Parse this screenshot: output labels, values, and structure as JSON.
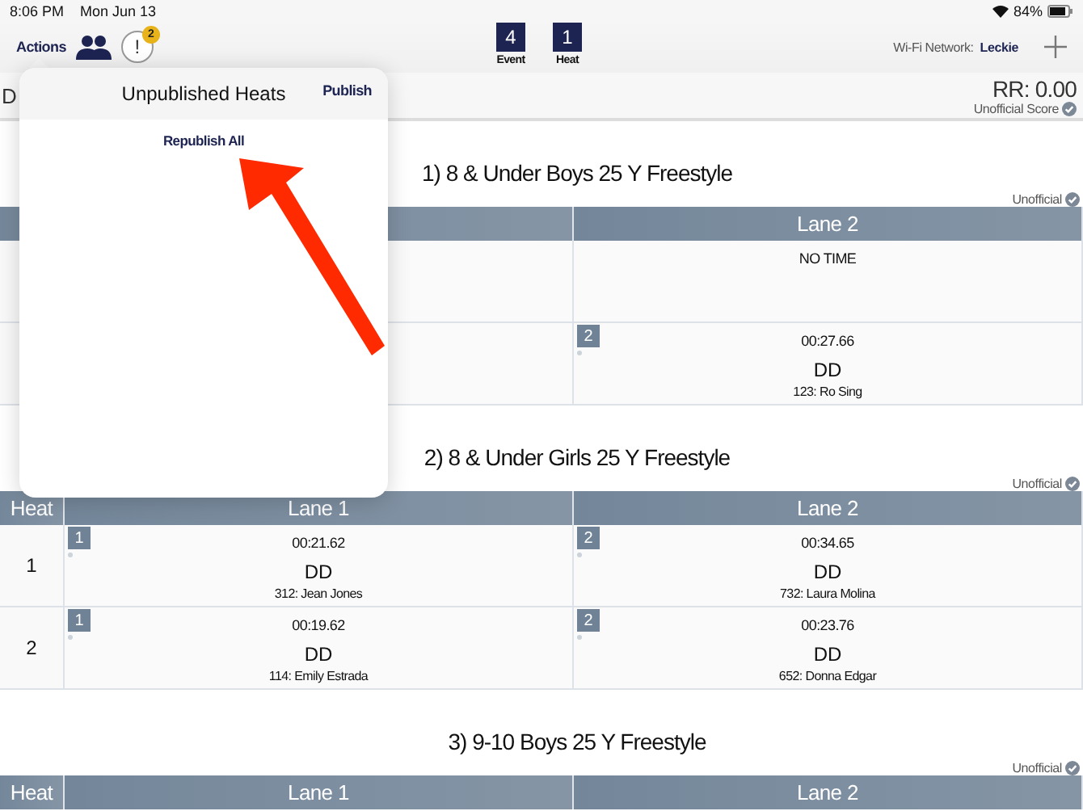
{
  "status_bar": {
    "time": "8:06 PM",
    "date": "Mon Jun 13",
    "battery": "84%"
  },
  "toolbar": {
    "actions": "Actions",
    "alert_symbol": "!",
    "alert_count": "2",
    "event": {
      "number": "4",
      "label": "Event"
    },
    "heat": {
      "number": "1",
      "label": "Heat"
    },
    "wifi_label": "Wi-Fi Network:",
    "wifi_name": "Leckie"
  },
  "header": {
    "left_text": "D",
    "rr": "RR: 0.00",
    "score_status": "Unofficial Score"
  },
  "popover": {
    "title": "Unpublished Heats",
    "action": "Publish",
    "link": "Republish All"
  },
  "events": [
    {
      "title": "1) 8 & Under Boys 25 Y Freestyle",
      "status": "Unofficial",
      "columns": {
        "lane_2": "Lane 2"
      },
      "rows": [
        {
          "lane_2": {
            "time": "NO TIME"
          }
        },
        {
          "lane_2": {
            "lane": "2",
            "time": "00:27.66",
            "code": "DD",
            "swimmer": "123: Ro  Sing"
          }
        }
      ]
    },
    {
      "title": "2) 8 & Under Girls 25 Y Freestyle",
      "status": "Unofficial",
      "columns": {
        "heat": "Heat",
        "lane_1": "Lane 1",
        "lane_2": "Lane 2"
      },
      "rows": [
        {
          "heat": "1",
          "lane_1": {
            "lane": "1",
            "time": "00:21.62",
            "code": "DD",
            "swimmer": "312: Jean Jones"
          },
          "lane_2": {
            "lane": "2",
            "time": "00:34.65",
            "code": "DD",
            "swimmer": "732: Laura Molina"
          }
        },
        {
          "heat": "2",
          "lane_1": {
            "lane": "1",
            "time": "00:19.62",
            "code": "DD",
            "swimmer": "114: Emily Estrada"
          },
          "lane_2": {
            "lane": "2",
            "time": "00:23.76",
            "code": "DD",
            "swimmer": "652: Donna Edgar"
          }
        }
      ]
    },
    {
      "title": "3) 9-10 Boys 25 Y Freestyle",
      "status": "Unofficial",
      "columns": {
        "heat": "Heat",
        "lane_1": "Lane 1",
        "lane_2": "Lane 2"
      }
    }
  ]
}
